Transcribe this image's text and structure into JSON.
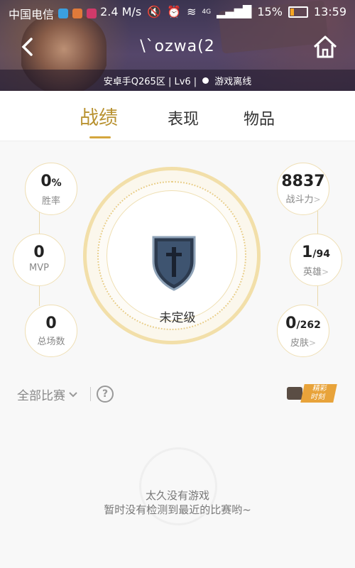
{
  "statusbar": {
    "carrier": "中国电信",
    "speed": "2.4 M/s",
    "network": "4G",
    "battery": "15%",
    "time": "13:59"
  },
  "header": {
    "title": "\\`ozwa(2",
    "zone": "安卓手Q265区 | Lv6 |",
    "status": "游戏离线"
  },
  "tabs": [
    {
      "label": "战绩",
      "active": true
    },
    {
      "label": "表现",
      "active": false
    },
    {
      "label": "物品",
      "active": false
    }
  ],
  "stats_left": [
    {
      "value": "0",
      "unit": "%",
      "label": "胜率"
    },
    {
      "value": "0",
      "unit": "",
      "label": "MVP"
    },
    {
      "value": "0",
      "unit": "",
      "label": "总场数"
    }
  ],
  "stats_right": [
    {
      "value": "8837",
      "unit": "",
      "label": "战斗力"
    },
    {
      "value": "1",
      "unit": "/94",
      "label": "英雄"
    },
    {
      "value": "0",
      "unit": "/262",
      "label": "皮肤"
    }
  ],
  "rank": {
    "label": "未定级"
  },
  "filter": {
    "label": "全部比赛",
    "help": "?"
  },
  "highlight": {
    "line1": "精彩",
    "line2": "时刻"
  },
  "empty": {
    "title": "太久没有游戏",
    "subtitle": "暂时没有检测到最近的比赛哟~"
  },
  "colors": {
    "accent": "#d4a63d",
    "accent_text": "#b8912f",
    "ring": "#f2dfa9"
  }
}
